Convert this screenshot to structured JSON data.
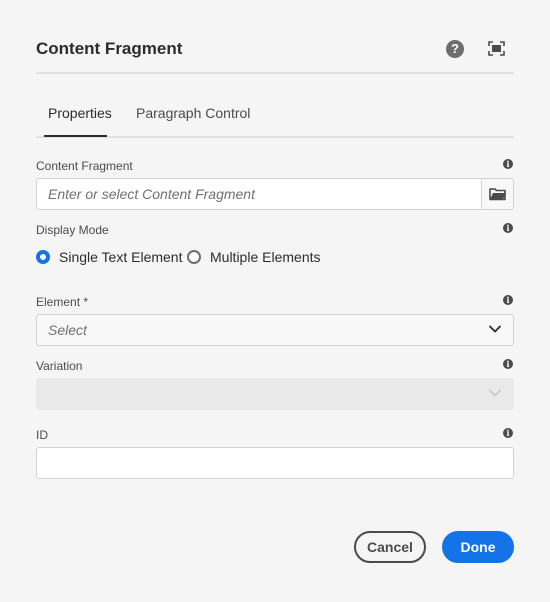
{
  "dialog": {
    "title": "Content Fragment",
    "help_glyph": "?",
    "icons": {
      "help": "help-icon",
      "fullscreen": "fullscreen-icon"
    }
  },
  "tabs": [
    {
      "label": "Properties",
      "active": true
    },
    {
      "label": "Paragraph Control",
      "active": false
    }
  ],
  "fields": {
    "content_fragment": {
      "label": "Content Fragment",
      "placeholder": "Enter or select Content Fragment",
      "value": ""
    },
    "display_mode": {
      "label": "Display Mode",
      "options": [
        {
          "label": "Single Text Element",
          "checked": true
        },
        {
          "label": "Multiple Elements",
          "checked": false
        }
      ]
    },
    "element": {
      "label": "Element *",
      "placeholder": "Select"
    },
    "variation": {
      "label": "Variation",
      "value": "",
      "disabled": true
    },
    "id": {
      "label": "ID",
      "value": ""
    }
  },
  "info_glyph": "i",
  "buttons": {
    "cancel": "Cancel",
    "done": "Done"
  },
  "colors": {
    "accent": "#1473e6",
    "background": "#f5f5f5",
    "text": "#4b4b4b"
  }
}
